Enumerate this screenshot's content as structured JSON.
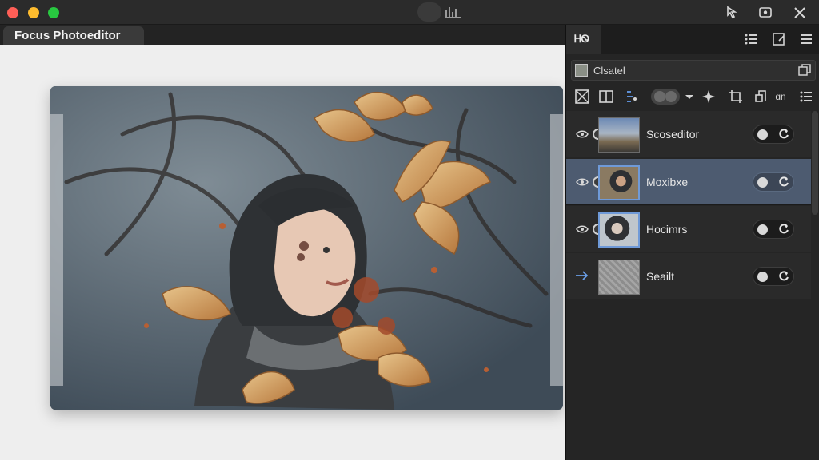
{
  "window": {
    "title_icons": [
      "close-traffic",
      "minimize-traffic",
      "zoom-traffic"
    ],
    "toolbar_right_icons": [
      "pointer-icon",
      "screen-record-icon",
      "close-icon"
    ]
  },
  "document": {
    "tab_title": "Focus Photoeditor"
  },
  "panel": {
    "tab_label": "ᎻᏫ",
    "header_icons": [
      "list-icon",
      "edit-document-icon",
      "menu-icon"
    ],
    "search_label": "Clsatel",
    "toolbar_icons": [
      "mask-icon",
      "book-icon",
      "adjust-icon",
      "blend-toggle",
      "chevron-down-icon",
      "star-icon",
      "crop-icon",
      "align-icon",
      "link-icon",
      "list-icon"
    ],
    "toolbar_text": "ɑn"
  },
  "layers": [
    {
      "name": "Scoseditor",
      "visible": true,
      "selected": false
    },
    {
      "name": "Moxibxe",
      "visible": true,
      "selected": true
    },
    {
      "name": "Hocimrs",
      "visible": true,
      "selected": false
    },
    {
      "name": "Seailt",
      "visible": false,
      "selected": false
    }
  ],
  "colors": {
    "accent_selected": "#4d5b70",
    "thumb_border": "#6f9ad8",
    "arrow": "#6a9fe8"
  }
}
